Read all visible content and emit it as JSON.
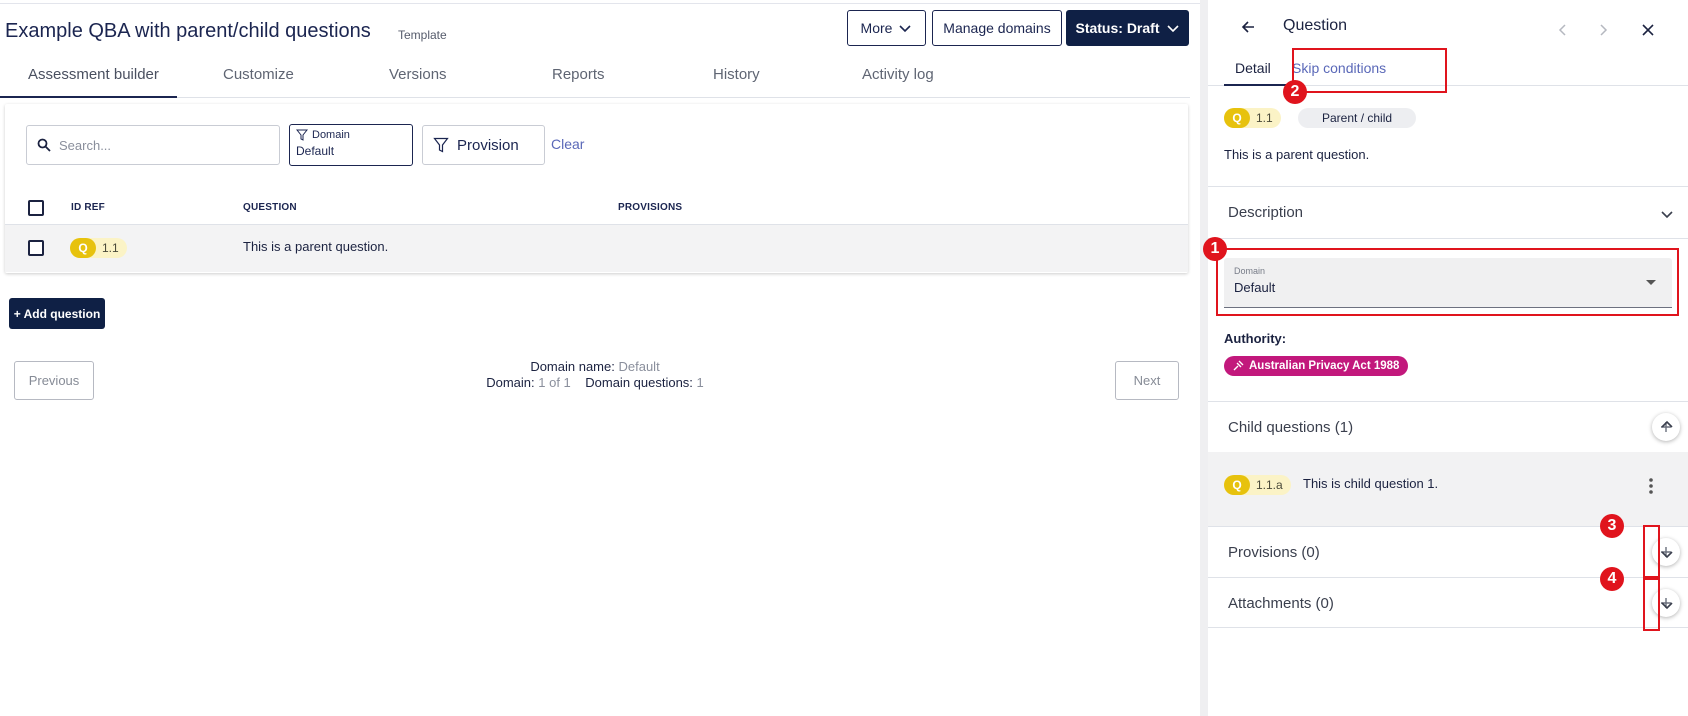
{
  "header": {
    "title": "Example QBA with parent/child questions",
    "template_label": "Template",
    "more_label": "More",
    "manage_domains_label": "Manage domains",
    "status_label": "Status: Draft"
  },
  "tabs": [
    "Assessment builder",
    "Customize",
    "Versions",
    "Reports",
    "History",
    "Activity log"
  ],
  "filters": {
    "search_placeholder": "Search...",
    "domain_label": "Domain",
    "domain_value": "Default",
    "provision_label": "Provision",
    "clear_label": "Clear"
  },
  "table": {
    "columns": [
      "ID REF",
      "QUESTION",
      "PROVISIONS"
    ],
    "rows": [
      {
        "badge": "Q",
        "id": "1.1",
        "question": "This is a parent question.",
        "provisions": ""
      }
    ]
  },
  "add_question_label": "+ Add question",
  "pager": {
    "previous_label": "Previous",
    "next_label": "Next",
    "domain_name_label": "Domain name:",
    "domain_name_value": "Default",
    "domain_label": "Domain:",
    "domain_value": "1 of 1",
    "domain_questions_label": "Domain questions:",
    "domain_questions_value": "1"
  },
  "panel": {
    "title": "Question",
    "tabs": [
      "Detail",
      "Skip conditions"
    ],
    "badge": "Q",
    "id": "1.1",
    "type_chip": "Parent / child",
    "text": "This is a parent question.",
    "description_label": "Description",
    "domain_select_label": "Domain",
    "domain_select_value": "Default",
    "authority_label": "Authority:",
    "authority_value": "Australian Privacy Act 1988",
    "child_questions_label": "Child questions (1)",
    "child": {
      "badge": "Q",
      "id": "1.1.a",
      "text": "This is child question 1."
    },
    "provisions_label": "Provisions (0)",
    "attachments_label": "Attachments (0)"
  },
  "annotations": [
    "1",
    "2",
    "3",
    "4"
  ],
  "colors": {
    "navy": "#0f2045",
    "q_badge": "#e7c20d",
    "authority": "#c2187c",
    "annotation": "#e0141d",
    "link": "#5a68b8"
  }
}
